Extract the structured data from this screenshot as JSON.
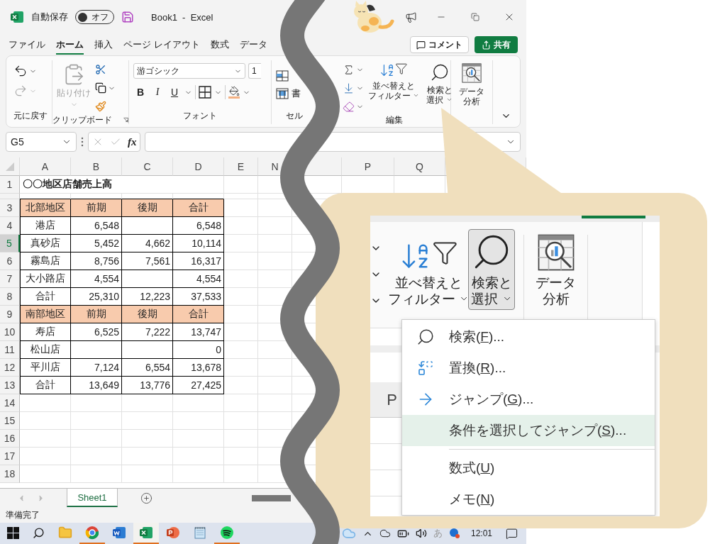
{
  "title_bar": {
    "autosave_label": "自動保存",
    "autosave": {
      "label": "オフ",
      "on": false
    },
    "title": "Book1  -  Excel"
  },
  "menu_tabs": [
    {
      "label": "ファイル",
      "selected": false
    },
    {
      "label": "ホーム",
      "selected": true
    },
    {
      "label": "挿入",
      "selected": false
    },
    {
      "label": "ページ レイアウト",
      "selected": false
    },
    {
      "label": "数式",
      "selected": false
    },
    {
      "label": "データ",
      "selected": false
    }
  ],
  "actions": {
    "comment": "コメント",
    "share": "共有"
  },
  "ribbon": {
    "undo": {
      "label": "元に戻す",
      "redo_disabled": true
    },
    "clipboard": {
      "label": "クリップボード",
      "paste": "貼り付け",
      "paste_disabled": true
    },
    "font": {
      "label": "フォント",
      "font_name": "游ゴシック",
      "font_size": "1",
      "bold": "B",
      "italic": "I",
      "underline": "U"
    },
    "cells": {
      "label": "セル",
      "format": "書"
    },
    "editing": {
      "label": "編集",
      "sort_filter": [
        "並べ替えと",
        "フィルター"
      ],
      "find_select": {
        "lines": [
          "検索と",
          "選択"
        ],
        "pressed": false
      }
    },
    "analysis": {
      "data_analysis": [
        "データ",
        "分析"
      ]
    }
  },
  "formula_bar": {
    "name_box": "G5",
    "function_label": "fx"
  },
  "sheet": {
    "columns": [
      "A",
      "B",
      "C",
      "D",
      "E",
      "N",
      "P",
      "Q"
    ],
    "rows": [
      {
        "number": "1",
        "kind": "title",
        "selected": false,
        "cells": [
          "〇〇地区店舗売上高"
        ]
      },
      {
        "kind": "spacer",
        "selected": false
      },
      {
        "number": "3",
        "kind": "header",
        "selected": false,
        "cells": [
          "北部地区",
          "前期",
          "後期",
          "合計"
        ]
      },
      {
        "number": "4",
        "kind": "data",
        "selected": false,
        "cells": [
          "港店",
          "6,548",
          null,
          "6,548"
        ]
      },
      {
        "number": "5",
        "kind": "data",
        "selected": true,
        "cells": [
          "真砂店",
          "5,452",
          "4,662",
          "10,114"
        ]
      },
      {
        "number": "6",
        "kind": "data",
        "selected": false,
        "cells": [
          "霧島店",
          "8,756",
          "7,561",
          "16,317"
        ]
      },
      {
        "number": "7",
        "kind": "data",
        "selected": false,
        "cells": [
          "大小路店",
          "4,554",
          null,
          "4,554"
        ]
      },
      {
        "number": "8",
        "kind": "data",
        "selected": false,
        "cells": [
          "合計",
          "25,310",
          "12,223",
          "37,533"
        ]
      },
      {
        "number": "9",
        "kind": "header",
        "selected": false,
        "cells": [
          "南部地区",
          "前期",
          "後期",
          "合計"
        ]
      },
      {
        "number": "10",
        "kind": "data",
        "selected": false,
        "cells": [
          "寿店",
          "6,525",
          "7,222",
          "13,747"
        ]
      },
      {
        "number": "11",
        "kind": "data",
        "selected": false,
        "cells": [
          "松山店",
          null,
          null,
          "0"
        ]
      },
      {
        "number": "12",
        "kind": "data",
        "selected": false,
        "cells": [
          "平川店",
          "7,124",
          "6,554",
          "13,678"
        ]
      },
      {
        "number": "13",
        "kind": "data",
        "selected": false,
        "cells": [
          "合計",
          "13,649",
          "13,776",
          "27,425"
        ]
      },
      {
        "number": "14",
        "kind": "empty",
        "selected": false
      },
      {
        "number": "15",
        "kind": "empty",
        "selected": false
      },
      {
        "number": "16",
        "kind": "empty",
        "selected": false
      },
      {
        "number": "17",
        "kind": "empty",
        "selected": false
      },
      {
        "number": "18",
        "kind": "empty",
        "selected": false
      }
    ]
  },
  "sheet_tabs": [
    {
      "label": "Sheet1",
      "selected": true
    }
  ],
  "status_bar": "準備完了",
  "taskbar": {
    "apps": [
      {
        "kind": "explorer",
        "running": false,
        "active": false
      },
      {
        "kind": "chrome",
        "running": true,
        "active": false
      },
      {
        "kind": "word",
        "running": false,
        "active": false
      },
      {
        "kind": "excel",
        "running": true,
        "active": true
      },
      {
        "kind": "powerpoint",
        "running": false,
        "active": false
      },
      {
        "kind": "notepad",
        "running": false,
        "active": false
      },
      {
        "kind": "spotify",
        "running": true,
        "active": false
      }
    ],
    "ime": "あ",
    "clock": "12:01"
  },
  "callout": {
    "sort_filter": [
      "並べ替えと",
      "フィルター"
    ],
    "find_select": {
      "lines": [
        "検索と",
        "選択"
      ],
      "pressed": true
    },
    "data_analysis": [
      "データ",
      "分析"
    ],
    "column_header": "P",
    "menu": [
      {
        "kind": "find",
        "before": "検索(",
        "key": "F",
        "after": ")...",
        "selected": false
      },
      {
        "kind": "replace",
        "before": "置換(",
        "key": "R",
        "after": ")...",
        "selected": false
      },
      {
        "kind": "goto",
        "before": "ジャンプ(",
        "key": "G",
        "after": ")...",
        "selected": false
      },
      {
        "kind": "plain",
        "before": "条件を選択してジャンプ(",
        "key": "S",
        "after": ")...",
        "selected": true
      },
      {
        "kind": "separator"
      },
      {
        "kind": "plain",
        "before": "数式(",
        "key": "U",
        "after": ")",
        "selected": false
      },
      {
        "kind": "plain",
        "before": "メモ(",
        "key": "N",
        "after": ")",
        "selected": false
      }
    ]
  }
}
